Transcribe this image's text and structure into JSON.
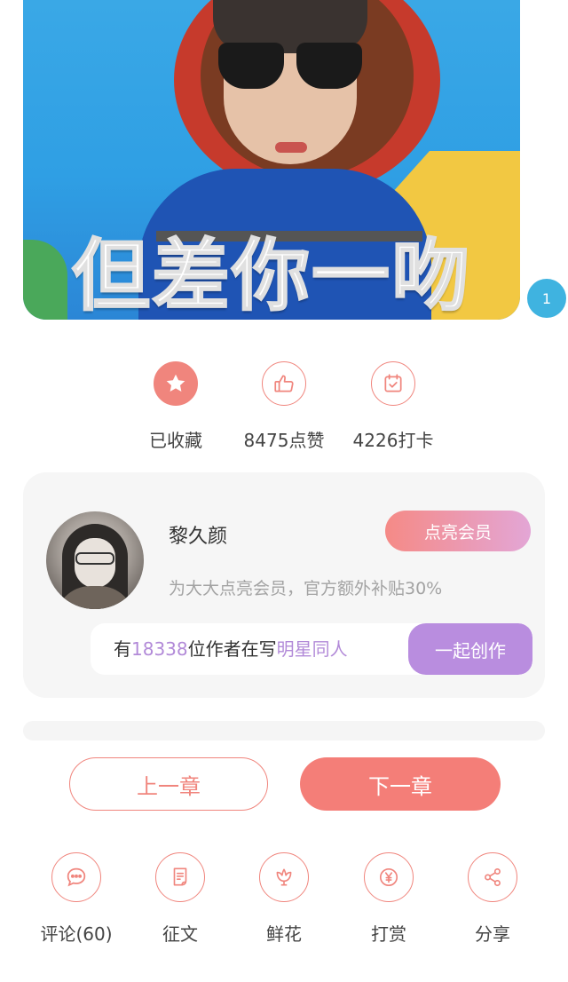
{
  "hero": {
    "caption": "但差你一吻"
  },
  "page_badge": "1",
  "actions": [
    {
      "label": "已收藏",
      "icon": "star-icon"
    },
    {
      "label": "8475点赞",
      "icon": "thumbs-up-icon"
    },
    {
      "label": "4226打卡",
      "icon": "calendar-check-icon"
    }
  ],
  "member_card": {
    "name": "黎久颜",
    "subtitle": "为大大点亮会员，官方额外补贴30%",
    "member_button": "点亮会员",
    "writer_prefix": "有",
    "writer_count": "18338",
    "writer_middle": "位作者在写",
    "writer_topic": "明星同人",
    "create_button": "一起创作"
  },
  "chapter_nav": {
    "prev": "上一章",
    "next": "下一章"
  },
  "tools": [
    {
      "label": "评论(60)",
      "icon": "comment-icon"
    },
    {
      "label": "征文",
      "icon": "essay-icon"
    },
    {
      "label": "鲜花",
      "icon": "flower-icon"
    },
    {
      "label": "打赏",
      "icon": "yen-icon"
    },
    {
      "label": "分享",
      "icon": "share-icon"
    }
  ],
  "colors": {
    "accent": "#f0857d",
    "purple": "#b98ddf",
    "badge": "#3fb3e0"
  }
}
